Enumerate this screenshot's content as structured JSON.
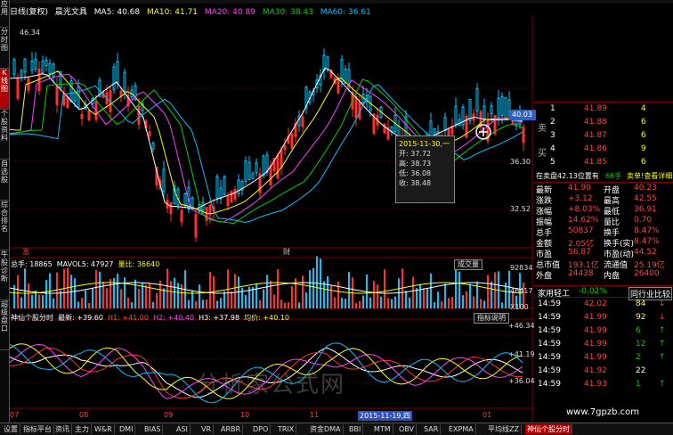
{
  "left_toolbar": [
    "应用",
    "分时图",
    "K线图",
    "个股资料",
    "自选股",
    "综合排名",
    "牛股诊断",
    "超级盘口"
  ],
  "chart_header": {
    "mode": "日线(复权)",
    "name": "晨光文具",
    "ma5": "MA5: 40.68",
    "ma10": "MA10: 41.71",
    "ma20": "MA20: 40.89",
    "ma30": "MA30: 38.43",
    "ma60": "MA60: 36.61"
  },
  "price_axis": {
    "high_mark": "46.34",
    "current": "40.03",
    "l1": "36.30",
    "l2": "32.52"
  },
  "markers": {
    "zhang": "涨",
    "cai": "财"
  },
  "tooltip": {
    "date": "2015-11-30,一",
    "open": "开: 37.72",
    "high": "高: 38.73",
    "low": "低: 36.08",
    "close": "收: 38.48"
  },
  "volume_header": {
    "total": "总手: 18865",
    "mavol5": "MAVOL5: 47927",
    "ratio": "量比: 36640",
    "button": "成交量",
    "axis_top": "92834",
    "axis_mid": "46417",
    "axis_unit": "X100"
  },
  "indicator_header": {
    "name": "神仙个股分时",
    "latest": "最新: +39.60",
    "h1": "H1: +41.00",
    "h2": "H2: +40.40",
    "h3": "H3: +37.98",
    "avg": "均价: +40.10",
    "button": "指标说明",
    "axis_top": "+46.34",
    "axis_mid": "+41.19",
    "axis_bot": "+36.04"
  },
  "x_axis": [
    "07",
    "08",
    "09",
    "10",
    "11",
    "01"
  ],
  "x_axis_highlight": "2015-11-19,四",
  "order_book": {
    "sell_label": "卖",
    "buy_label": "买",
    "sell": [
      {
        "level": "5",
        "price": "41.89",
        "vol": "6"
      },
      {
        "level": "4",
        "price": "41.88",
        "vol": "9"
      },
      {
        "level": "3",
        "price": "41.87",
        "vol": "6"
      },
      {
        "level": "2",
        "price": "41.86",
        "vol": "6"
      },
      {
        "level": "1",
        "price": "41.85",
        "vol": "4"
      }
    ]
  },
  "ob_status": {
    "left": "在卖盘42.13位置有",
    "mid": "66手",
    "right": "卖单!查看详细"
  },
  "quote_grid": [
    [
      "最新",
      "41.90",
      "开盘",
      "40.23"
    ],
    [
      "涨跌",
      "+3.12",
      "最高",
      "42.55"
    ],
    [
      "涨幅",
      "+8.03%",
      "最低",
      "36.91"
    ],
    [
      "振幅",
      "14.62%",
      "量比",
      "0.70"
    ],
    [
      "总手",
      "50837",
      "换手",
      "8.47%"
    ],
    [
      "金额",
      "2.05亿",
      "换手(实)",
      "8.47%"
    ],
    [
      "市盈",
      "56.87",
      "市盈(动)",
      "44.52"
    ],
    [
      "总市值",
      "193.1亿",
      "流通值",
      "25.19亿"
    ],
    [
      "外盘",
      "24438",
      "内盘",
      "26400"
    ]
  ],
  "industry": {
    "name": "家用轻工",
    "change": "-0.02%",
    "rank": "同行业比较"
  },
  "ticks": [
    {
      "time": "14:59",
      "price": "42.02",
      "vol": "84"
    },
    {
      "time": "14:59",
      "price": "41.99",
      "vol": "92"
    },
    {
      "time": "14:59",
      "price": "41.99",
      "vol": "6"
    },
    {
      "time": "14:59",
      "price": "41.99",
      "vol": "12"
    },
    {
      "time": "14:59",
      "price": "41.99",
      "vol": "2"
    },
    {
      "time": "14:59",
      "price": "41.92",
      "vol": "22"
    },
    {
      "time": "14:59",
      "price": "41.93",
      "vol": "1"
    }
  ],
  "bottom_tabs": [
    "设置",
    "指标平台",
    "资讯",
    "主力",
    "W&R",
    "DMI",
    "BIAS",
    "ASI",
    "VR",
    "ARBR",
    "DPO",
    "TRIX",
    "资金DMA",
    "BBI",
    "MTM",
    "OBV",
    "SAR",
    "EXPMA",
    "平均线ZZ",
    "神仙个股分时"
  ],
  "watermark": "分析家公式网",
  "website": "www.7gpzb.com"
}
